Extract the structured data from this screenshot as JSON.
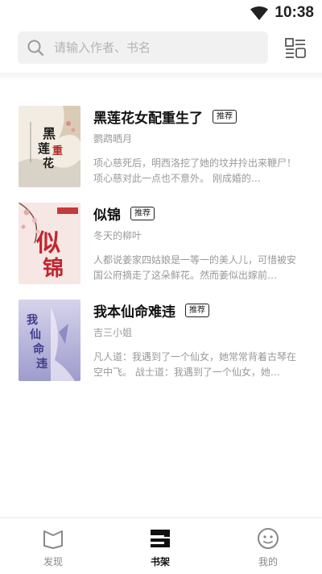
{
  "status_bar": {
    "time": "10:38",
    "wifi_icon": "wifi-icon"
  },
  "search": {
    "placeholder": "请输入作者、书名",
    "icon": "search-icon",
    "toggle_icon": "list-view-icon"
  },
  "books": [
    {
      "title": "黑莲花女配重生了",
      "badge": "推荐",
      "author": "鹦鹉晒月",
      "desc": "项心慈死后，明西洛挖了她的坟并拎出来鞭尸！ 项心慈对此一点也不意外。 刚成婚的…",
      "cover_theme": "ink-wash"
    },
    {
      "title": "似锦",
      "badge": "推荐",
      "author": "冬天的柳叶",
      "desc": "人都说姜家四姑娘是一等一的美人儿，可惜被安国公府摘走了这朵鲜花。然而姜似出嫁前…",
      "cover_theme": "pink-blossom"
    },
    {
      "title": "我本仙命难违",
      "badge": "推荐",
      "author": "吉三小姐",
      "desc": "凡人道：我遇到了一个仙女，她常常背着古琴在空中飞。 战士道：我遇到了一个仙女，她…",
      "cover_theme": "purple-fairy"
    }
  ],
  "tabs": [
    {
      "label": "发现",
      "icon": "discover-icon",
      "active": false
    },
    {
      "label": "书架",
      "icon": "bookshelf-icon",
      "active": true
    },
    {
      "label": "我的",
      "icon": "profile-icon",
      "active": false
    }
  ],
  "colors": {
    "accent": "#111111",
    "inactive": "#888888",
    "search_bg": "#f1f1f1",
    "meta_text": "#999999"
  }
}
